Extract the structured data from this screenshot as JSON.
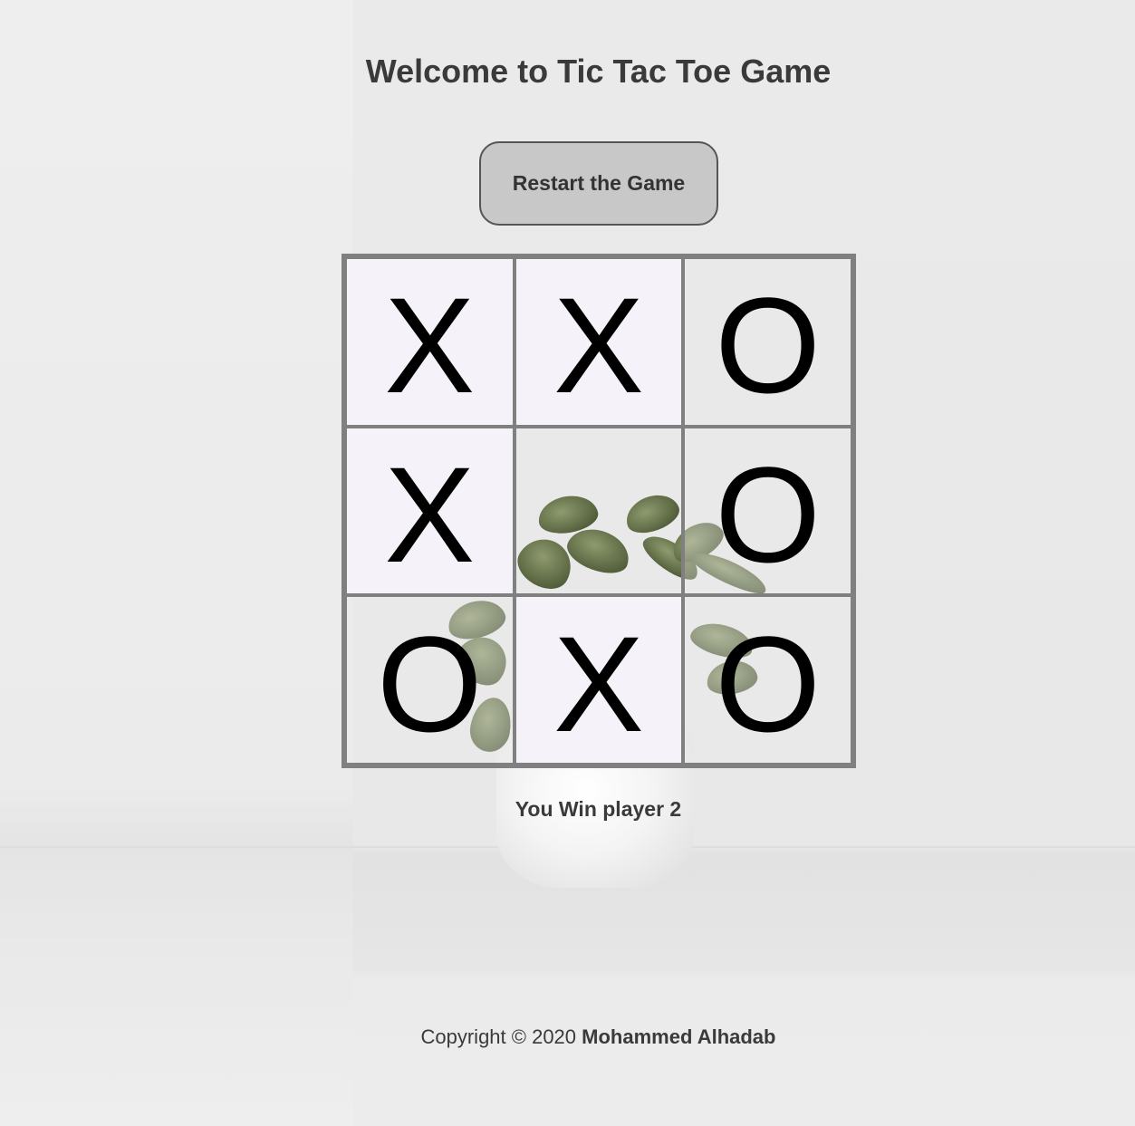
{
  "header": {
    "title": "Welcome to Tic Tac Toe Game"
  },
  "controls": {
    "restart_label": "Restart the Game"
  },
  "board": {
    "cells": [
      "X",
      "X",
      "O",
      "X",
      "",
      "O",
      "O",
      "X",
      "O"
    ]
  },
  "status": {
    "message": "You Win player 2"
  },
  "footer": {
    "copyright_prefix": "Copyright © 2020",
    "author": "Mohammed Alhadab"
  }
}
